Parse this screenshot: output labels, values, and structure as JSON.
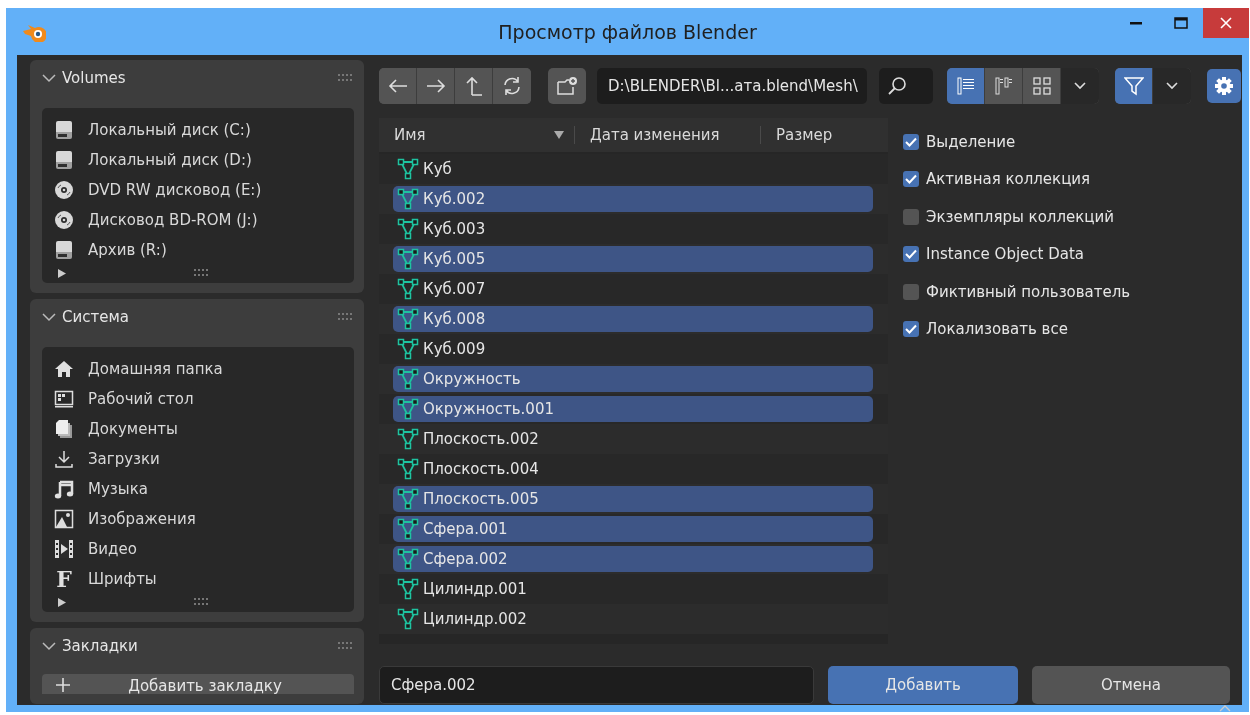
{
  "window": {
    "title": "Просмотр файлов Blender"
  },
  "sidebar": {
    "panels": [
      {
        "title": "Volumes",
        "expanded": true,
        "items": [
          {
            "label": "Локальный диск (C:)",
            "kind": "drive"
          },
          {
            "label": "Локальный диск (D:)",
            "kind": "drive"
          },
          {
            "label": "DVD RW дисковод (E:)",
            "kind": "disc"
          },
          {
            "label": "Дисковод BD-ROM (J:)",
            "kind": "disc"
          },
          {
            "label": "Архив (R:)",
            "kind": "drive"
          }
        ]
      },
      {
        "title": "Система",
        "expanded": true,
        "items": [
          {
            "label": "Домашняя папка",
            "kind": "home"
          },
          {
            "label": "Рабочий стол",
            "kind": "desktop"
          },
          {
            "label": "Документы",
            "kind": "documents"
          },
          {
            "label": "Загрузки",
            "kind": "download"
          },
          {
            "label": "Музыка",
            "kind": "music"
          },
          {
            "label": "Изображения",
            "kind": "image"
          },
          {
            "label": "Видео",
            "kind": "video"
          },
          {
            "label": "Шрифты",
            "kind": "font",
            "glyph": "F"
          }
        ]
      },
      {
        "title": "Закладки",
        "expanded": true,
        "button": "Добавить закладку"
      }
    ]
  },
  "toolbar": {
    "path": "D:\\BLENDER\\Bl...ата.blend\\Mesh\\",
    "display_modes": [
      {
        "kind": "vertical_list",
        "selected": true
      },
      {
        "kind": "horizontal_list",
        "selected": false
      },
      {
        "kind": "thumbnails",
        "selected": false
      }
    ],
    "filter_on": true
  },
  "file_list": {
    "columns": [
      {
        "label": "Имя",
        "sorted": true
      },
      {
        "label": "Дата изменения",
        "sorted": false
      },
      {
        "label": "Размер",
        "sorted": false
      }
    ],
    "rows": [
      {
        "name": "Куб",
        "selected": false
      },
      {
        "name": "Куб.002",
        "selected": true
      },
      {
        "name": "Куб.003",
        "selected": false
      },
      {
        "name": "Куб.005",
        "selected": true
      },
      {
        "name": "Куб.007",
        "selected": false
      },
      {
        "name": "Куб.008",
        "selected": true
      },
      {
        "name": "Куб.009",
        "selected": false
      },
      {
        "name": "Окружность",
        "selected": true
      },
      {
        "name": "Окружность.001",
        "selected": true
      },
      {
        "name": "Плоскость.002",
        "selected": false
      },
      {
        "name": "Плоскость.004",
        "selected": false
      },
      {
        "name": "Плоскость.005",
        "selected": true
      },
      {
        "name": "Сфера.001",
        "selected": true
      },
      {
        "name": "Сфера.002",
        "selected": true
      },
      {
        "name": "Цилиндр.001",
        "selected": false
      },
      {
        "name": "Цилиндр.002",
        "selected": false
      }
    ]
  },
  "options": [
    {
      "label": "Выделение",
      "checked": true
    },
    {
      "label": "Активная коллекция",
      "checked": true
    },
    {
      "label": "Экземпляры коллекций",
      "checked": false
    },
    {
      "label": "Instance Object Data",
      "checked": true
    },
    {
      "label": "Фиктивный пользователь",
      "checked": false
    },
    {
      "label": "Локализовать все",
      "checked": true
    }
  ],
  "filename": {
    "value": "Сфера.002"
  },
  "buttons": [
    {
      "label": "Добавить",
      "kind": "primary"
    },
    {
      "label": "Отмена",
      "kind": "secondary"
    }
  ]
}
